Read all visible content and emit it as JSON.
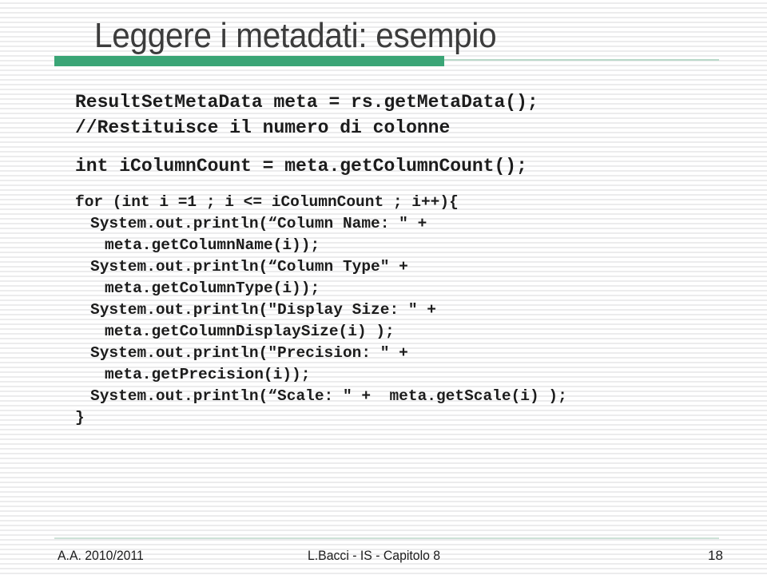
{
  "slide": {
    "title": "Leggere i metadati: esempio",
    "accent_color": "#3aa576",
    "accent_light_color": "#b9d9c9",
    "title_color": "#3c3c3c",
    "background_color": "#ffffff"
  },
  "code": {
    "intro_lines": [
      "ResultSetMetaData meta = rs.getMetaData();",
      "//Restituisce il numero di colonne"
    ],
    "count_line": "int iColumnCount = meta.getColumnCount();",
    "loop_open": "for (int i =1 ; i <= iColumnCount ; i++){",
    "body_lines": [
      "System.out.println(“Column Name: \" +",
      "meta.getColumnName(i));",
      "System.out.println(“Column Type\" +",
      "meta.getColumnType(i));",
      "System.out.println(\"Display Size: \" +",
      "meta.getColumnDisplaySize(i) );",
      "System.out.println(\"Precision: \" +",
      "meta.getPrecision(i));",
      "System.out.println(“Scale: \" +  meta.getScale(i) );"
    ],
    "loop_close": "}"
  },
  "footer": {
    "left": "A.A. 2010/2011",
    "center": "L.Bacci - IS - Capitolo 8",
    "page_number": "18"
  }
}
